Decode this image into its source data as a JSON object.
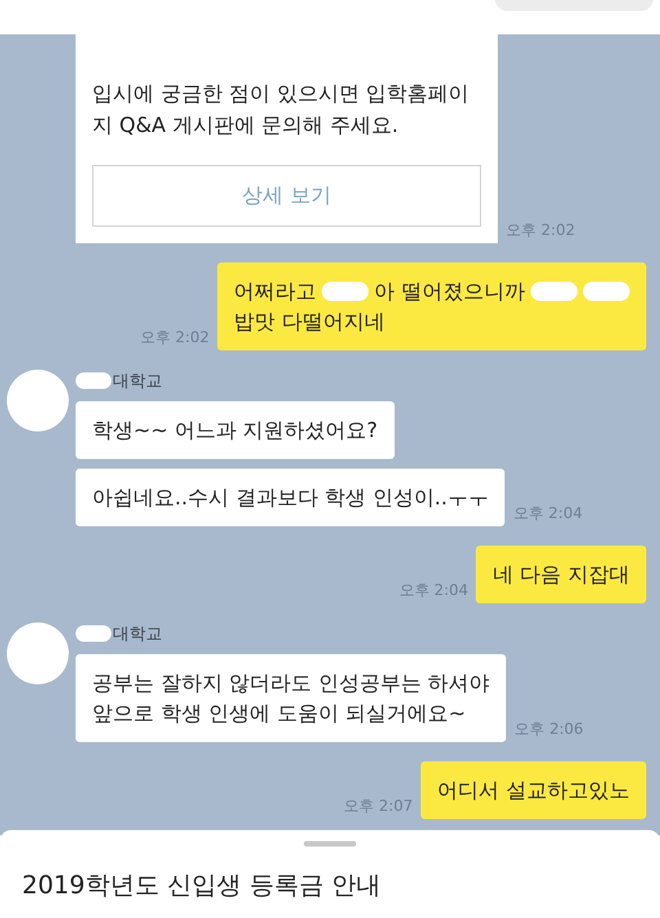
{
  "messages": [
    {
      "kind": "card",
      "lines": [
        "입시에 궁금한 점이 있으시면 입학홈페이",
        "지 Q&A 게시판에 문의해 주세요."
      ],
      "button": "상세 보기",
      "time": "오후 2:02"
    },
    {
      "kind": "sent",
      "lines": [
        [
          {
            "kind": "text",
            "text": "어쩌라고"
          },
          {
            "kind": "redacted"
          },
          {
            "kind": "text",
            "text": "아 떨어졌으니까"
          },
          {
            "kind": "redacted"
          },
          {
            "kind": "redacted"
          }
        ],
        [
          {
            "kind": "text",
            "text": "밥맛 다떨어지네"
          }
        ]
      ],
      "time": "오후 2:02"
    },
    {
      "kind": "received",
      "sender": {
        "name": "대학교",
        "redacted": true
      },
      "bubbles": [
        {
          "lines": [
            "학생~~ 어느과 지원하셨어요?"
          ]
        },
        {
          "lines": [
            "아쉽네요..수시 결과보다 학생 인성이..ㅜㅜ"
          ]
        }
      ],
      "time": "오후 2:04"
    },
    {
      "kind": "sent",
      "lines": [
        [
          {
            "kind": "text",
            "text": "네 다음 지잡대"
          }
        ]
      ],
      "time": "오후 2:04"
    },
    {
      "kind": "received",
      "sender": {
        "name": "대학교",
        "redacted": true
      },
      "bubbles": [
        {
          "lines": [
            "공부는 잘하지 않더라도 인성공부는 하셔야",
            "앞으로 학생 인생에 도움이 되실거에요~"
          ]
        }
      ],
      "time": "오후 2:06"
    },
    {
      "kind": "sent",
      "lines": [
        [
          {
            "kind": "text",
            "text": "어디서 설교하고있노"
          }
        ]
      ],
      "time": "오후 2:07"
    }
  ],
  "sheet": {
    "title": "2019학년도 신입생 등록금 안내"
  }
}
